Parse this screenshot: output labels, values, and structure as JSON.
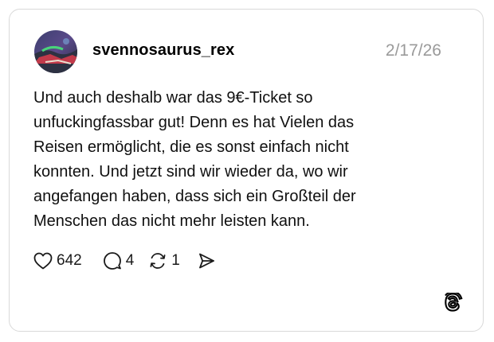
{
  "post": {
    "username": "svennosaurus_rex",
    "date": "2/17/26",
    "text": "Und auch deshalb war das 9€-Ticket so\nunfuckingfassbar gut! Denn es hat Vielen das\nReisen ermöglicht, die es sonst einfach nicht\nkonnten. Und jetzt sind wir wieder da, wo wir\nangefangen haben, dass sich ein Großteil der\nMenschen das nicht mehr leisten kann."
  },
  "actions": {
    "likes": "642",
    "replies": "4",
    "reposts": "1"
  },
  "icons": {
    "like": "heart-icon",
    "reply": "comment-bubble-icon",
    "repost": "repost-icon",
    "share": "send-icon",
    "brand": "threads-logo-icon"
  },
  "colors": {
    "text": "#101010",
    "muted": "#9a9a9a",
    "border": "#d9d9d9"
  }
}
